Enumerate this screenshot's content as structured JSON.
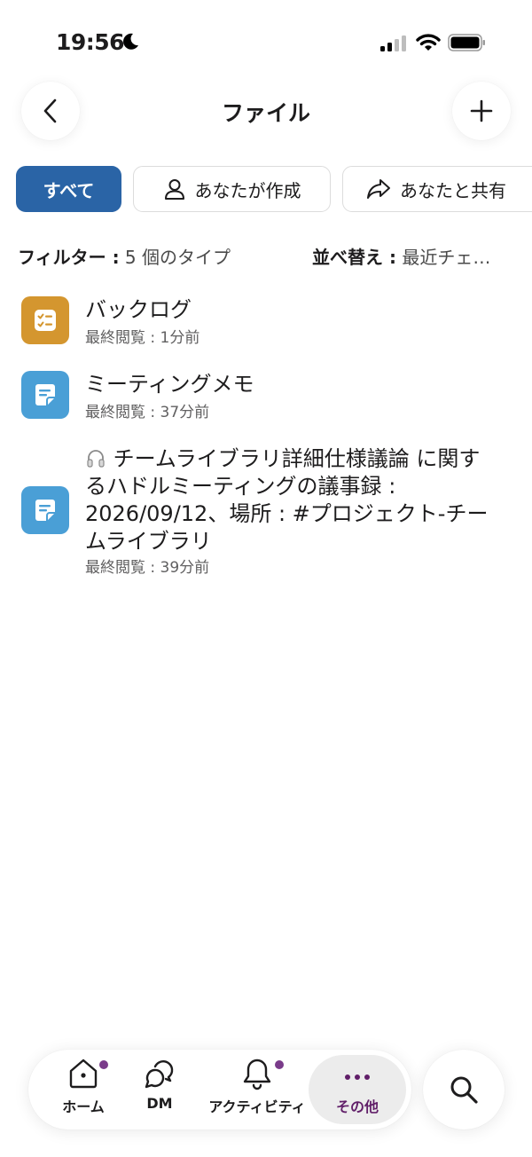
{
  "status_bar": {
    "time": "19:56"
  },
  "header": {
    "title": "ファイル"
  },
  "chips": {
    "all": "すべて",
    "created_by_you": "あなたが作成",
    "shared_with_you": "あなたと共有"
  },
  "filter": {
    "label": "フィルター :",
    "value": "5 個のタイプ"
  },
  "sort": {
    "label": "並べ替え :",
    "value": "最近チェ…"
  },
  "files": [
    {
      "title": "バックログ",
      "meta": "最終閲覧 : 1分前",
      "icon": "checklist-icon"
    },
    {
      "title": "ミーティングメモ",
      "meta": "最終閲覧 : 37分前",
      "icon": "canvas-note-icon"
    },
    {
      "title_line1": "チームライブラリ詳細仕様議論 に関す",
      "title_line2": "るハドルミーティングの議事録 :",
      "title_line3": "2026/09/12、場所 : #プロジェクト-チー",
      "title_line4": "ムライブラリ",
      "meta": "最終閲覧 : 39分前",
      "icon": "canvas-note-icon",
      "prefix_icon": "headphones-icon"
    }
  ],
  "tabbar": {
    "home": "ホーム",
    "dm": "DM",
    "activity": "アクティビティ",
    "more": "その他"
  },
  "colors": {
    "accent_blue": "#2a64a6",
    "backlog_orange": "#d4962f",
    "canvas_blue": "#4a9fd6",
    "badge_purple": "#7a3b8a",
    "more_purple": "#611f69"
  }
}
